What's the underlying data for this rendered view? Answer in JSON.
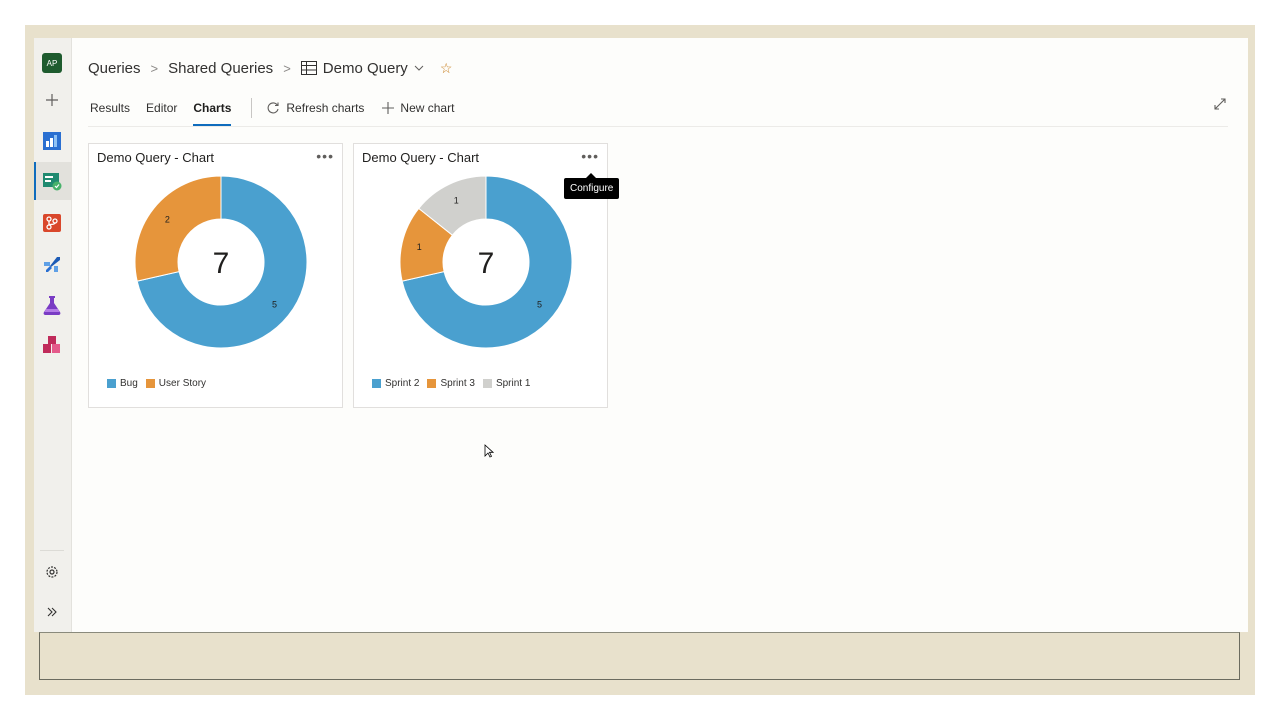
{
  "rail": {
    "avatar_text": "AP",
    "icons": [
      "add-icon",
      "boards-icon",
      "queries-icon",
      "repos-icon",
      "pipelines-icon",
      "test-plans-icon",
      "artifacts-icon",
      "settings-icon",
      "expand-rail-icon"
    ]
  },
  "breadcrumb": {
    "root": "Queries",
    "folder": "Shared Queries",
    "current": "Demo Query"
  },
  "tabs": {
    "results": "Results",
    "editor": "Editor",
    "charts": "Charts",
    "refresh": "Refresh charts",
    "new_chart": "New chart"
  },
  "tooltip": "Configure",
  "colors": {
    "blue": "#4aa0cf",
    "orange": "#e6953b",
    "gray": "#d0d0cd",
    "accent": "#0f6cbd"
  },
  "chart_data": [
    {
      "type": "pie",
      "title": "Demo Query - Chart",
      "total": "7",
      "categories": [
        "Bug",
        "User Story"
      ],
      "values": [
        5,
        2
      ],
      "colors": [
        "#4aa0cf",
        "#e6953b"
      ]
    },
    {
      "type": "pie",
      "title": "Demo Query - Chart",
      "total": "7",
      "categories": [
        "Sprint 2",
        "Sprint 3",
        "Sprint 1"
      ],
      "values": [
        5,
        1,
        1
      ],
      "colors": [
        "#4aa0cf",
        "#e6953b",
        "#d0d0cd"
      ]
    }
  ]
}
